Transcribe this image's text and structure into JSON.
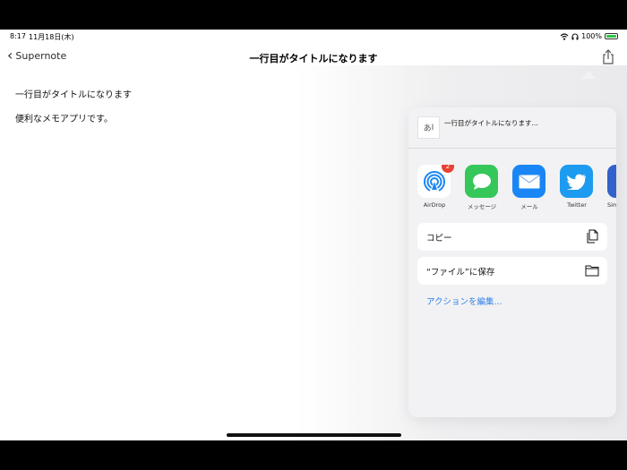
{
  "status": {
    "time": "8:17",
    "date": "11月18日(木)",
    "battery": "100%"
  },
  "nav": {
    "back_label": "Supernote",
    "title": "一行目がタイトルになります"
  },
  "note": {
    "lines": [
      "一行目がタイトルになります",
      "便利なメモアプリです。"
    ]
  },
  "share_sheet": {
    "header_title": "一行目がタイトルになります...",
    "thumb_glyph": "あ",
    "apps": [
      {
        "label": "AirDrop",
        "icon": "airdrop-icon",
        "badge": "2",
        "color": "#ffffff"
      },
      {
        "label": "メッセージ",
        "icon": "messages-icon",
        "color": "#35c759"
      },
      {
        "label": "メール",
        "icon": "mail-icon",
        "color": "#1a86f5"
      },
      {
        "label": "Twitter",
        "icon": "twitter-icon",
        "color": "#1d9bf0"
      },
      {
        "label": "Sim",
        "icon": "simplenote-icon",
        "color": "#3361cc"
      }
    ],
    "actions": [
      {
        "label": "コピー",
        "icon": "copy-icon"
      },
      {
        "label": "“ファイル”に保存",
        "icon": "folder-icon"
      }
    ],
    "edit_actions_label": "アクションを編集..."
  }
}
